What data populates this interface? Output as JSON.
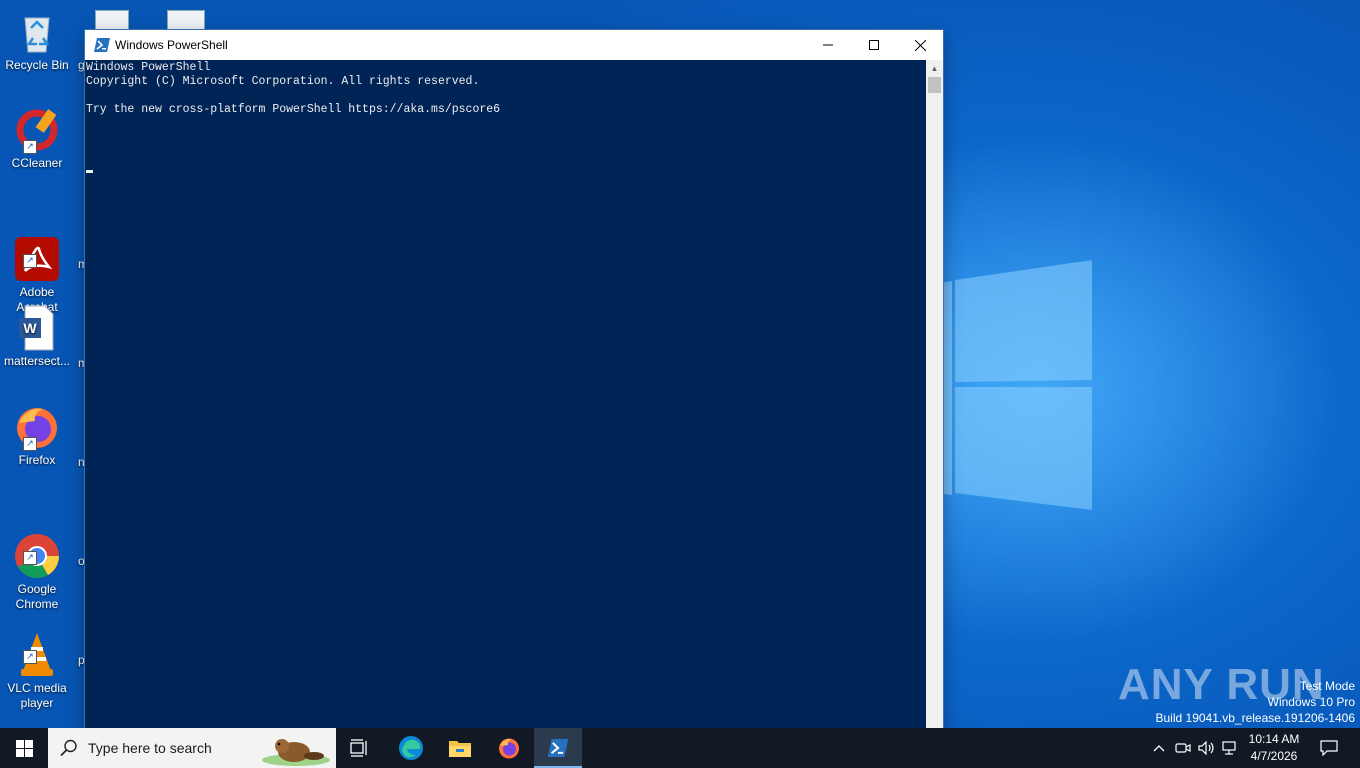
{
  "desktop": {
    "icons": [
      {
        "label": "Recycle Bin",
        "icon": "recycle-bin-icon"
      },
      {
        "label": "CCleaner",
        "icon": "ccleaner-icon"
      },
      {
        "label": "Adobe\nAcrobat",
        "icon": "adobe-acrobat-icon"
      },
      {
        "label": "mattersect...",
        "icon": "word-document-icon"
      },
      {
        "label": "Firefox",
        "icon": "firefox-icon"
      },
      {
        "label": "Google\nChrome",
        "icon": "chrome-icon"
      },
      {
        "label": "VLC media\nplayer",
        "icon": "vlc-icon"
      }
    ],
    "partial_labels": [
      "g",
      "m",
      "m",
      "n",
      "o",
      "p"
    ]
  },
  "window": {
    "title": "Windows PowerShell",
    "controls": {
      "minimize": "—",
      "maximize": "☐",
      "close": "✕"
    },
    "console_lines": [
      "Windows PowerShell",
      "Copyright (C) Microsoft Corporation. All rights reserved.",
      "",
      "Try the new cross-platform PowerShell https://aka.ms/pscore6"
    ]
  },
  "watermark": {
    "brand": "ANY RUN",
    "mode": "Test Mode",
    "edition": "Windows 10 Pro",
    "build": "Build 19041.vb_release.191206-1406"
  },
  "taskbar": {
    "search_placeholder": "Type here to search",
    "apps": [
      "task-view-icon",
      "edge-icon",
      "file-explorer-icon",
      "firefox-icon",
      "powershell-icon"
    ],
    "active_app": "powershell-icon",
    "tray_icons": [
      "chevron-up-icon",
      "meet-now-icon",
      "volume-icon",
      "network-icon"
    ],
    "time": "10:14 AM",
    "date": "4/7/2026",
    "notification_icon": "notification-icon"
  },
  "colors": {
    "console_bg": "#012456",
    "console_fg": "#eeedf0",
    "taskbar_bg": "#111a24",
    "desktop_blue": "#0b63c6"
  }
}
